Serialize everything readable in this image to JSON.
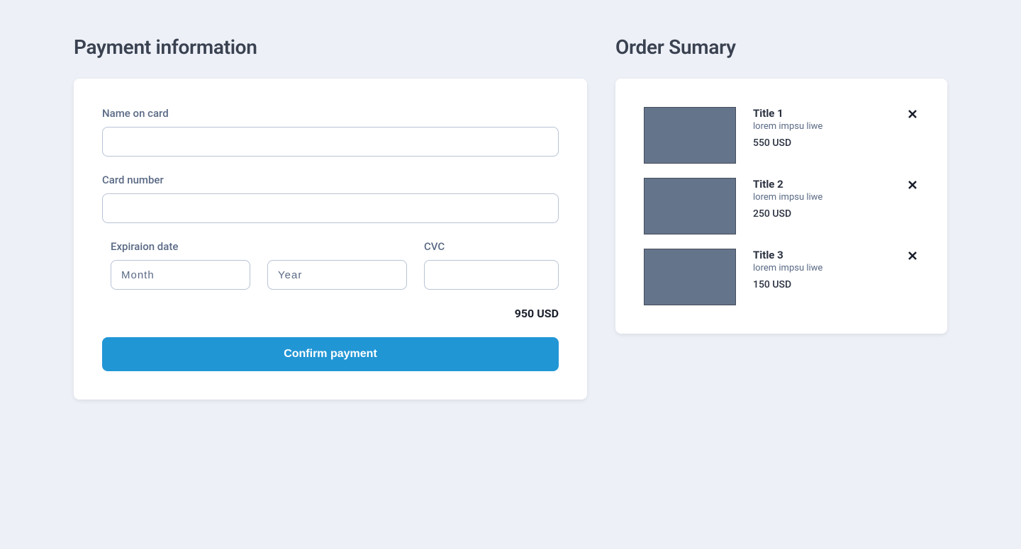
{
  "payment": {
    "heading": "Payment information",
    "labels": {
      "name": "Name on card",
      "card_number": "Card number",
      "expiration": "Expiraion date",
      "cvc": "CVC"
    },
    "placeholders": {
      "month": "Month",
      "year": "Year"
    },
    "values": {
      "name": "",
      "card_number": "",
      "month": "",
      "year": "",
      "cvc": ""
    },
    "total": "950 USD",
    "confirm_button": "Confirm payment"
  },
  "summary": {
    "heading": "Order Sumary",
    "items": [
      {
        "title": "Title 1",
        "description": "lorem impsu liwe",
        "price": "550 USD"
      },
      {
        "title": "Title 2",
        "description": "lorem impsu liwe",
        "price": "250 USD"
      },
      {
        "title": "Title 3",
        "description": "lorem impsu liwe",
        "price": "150 USD"
      }
    ]
  }
}
